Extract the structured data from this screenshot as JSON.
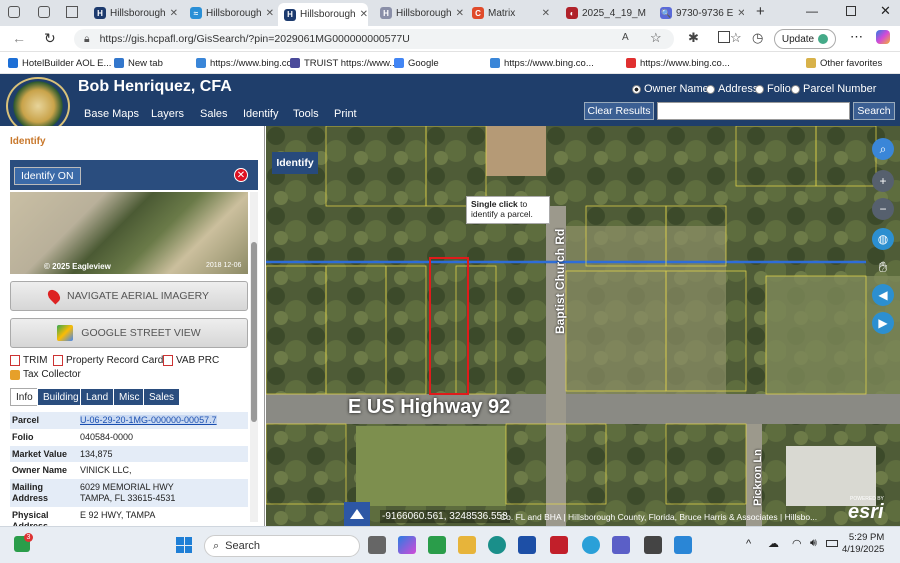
{
  "browser": {
    "tabs": [
      {
        "label": "Hillsborough",
        "fav_color": "#1d3b6e",
        "fav_glyph": "H"
      },
      {
        "label": "Hillsborough",
        "fav_color": "#2a8fd6",
        "fav_glyph": "≈"
      },
      {
        "label": "Hillsborough",
        "fav_color": "#1d3b6e",
        "fav_glyph": "H",
        "active": true
      },
      {
        "label": "Hillsborough",
        "fav_color": "#8a8fa8",
        "fav_glyph": "H"
      },
      {
        "label": "Matrix",
        "fav_color": "#e04a2a",
        "fav_glyph": "C"
      },
      {
        "label": "2025_4_19_M",
        "fav_color": "#b0222a",
        "fav_glyph": "◐"
      },
      {
        "label": "9730-9736 E",
        "fav_color": "#5a6ad8",
        "fav_glyph": "🔍"
      }
    ],
    "url": "https://gis.hcpafl.org/GisSearch/?pin=2029061MG000000000577U",
    "update_label": "Update",
    "favorites": [
      "HotelBuilder AOL E...",
      "New tab",
      "https://www.bing.co...",
      "TRUIST https://www....",
      "Google",
      "https://www.bing.co...",
      "https://www.bing.co..."
    ],
    "other_favorites": "Other favorites"
  },
  "app": {
    "owner_title": "Bob Henriquez,  CFA",
    "menu": [
      "Base Maps",
      "Layers",
      "Sales",
      "Identify",
      "Tools",
      "Print"
    ],
    "search_options": [
      {
        "label": "Owner Name",
        "selected": true
      },
      {
        "label": "Address",
        "selected": false
      },
      {
        "label": "Folio",
        "selected": false
      },
      {
        "label": "Parcel Number",
        "selected": false
      }
    ],
    "clear_results": "Clear Results",
    "search_button": "Search"
  },
  "panel": {
    "title": "Identify",
    "identify_on": "Identify ON",
    "thumb_caption": "© 2025 Eagleview",
    "thumb_date": "2018 12-06",
    "navigate_aerial": "NAVIGATE AERIAL IMAGERY",
    "google_street": "GOOGLE STREET VIEW",
    "links": [
      "TRIM",
      "Property Record Card",
      "VAB PRC",
      "Tax Collector"
    ],
    "subtabs": [
      "Info",
      "Building",
      "Land",
      "Misc",
      "Sales"
    ],
    "details": [
      {
        "key": "Parcel",
        "value": "U-06-29-20-1MG-000000-00057.7"
      },
      {
        "key": "Folio",
        "value": "040584-0000"
      },
      {
        "key": "Market Value",
        "value": "134,875"
      },
      {
        "key": "Owner Name",
        "value": "VINICK LLC,"
      },
      {
        "key": "Mailing Address",
        "value": "6029 MEMORIAL HWY",
        "value2": "TAMPA, FL 33615-4531"
      },
      {
        "key": "Physical Address",
        "value": "E 92 HWY, TAMPA"
      }
    ]
  },
  "map": {
    "identify_btn": "Identify",
    "tooltip_bold": "Single click",
    "tooltip_rest": " to identify a parcel.",
    "road_main": "E US Highway 92",
    "road_side": "Baptist Church Rd",
    "road_pickron": "Pickron Ln",
    "coords": "-9166060.561, 3248536.558",
    "attribution": "Co. FL and BHA | Hillsborough County, Florida, Bruce Harris & Associates | Hillsbo...",
    "esri": "esri",
    "esri_powered": "POWERED BY"
  },
  "taskbar": {
    "search_placeholder": "Search",
    "time": "5:29 PM",
    "date": "4/19/2025",
    "notification_count": "3"
  }
}
